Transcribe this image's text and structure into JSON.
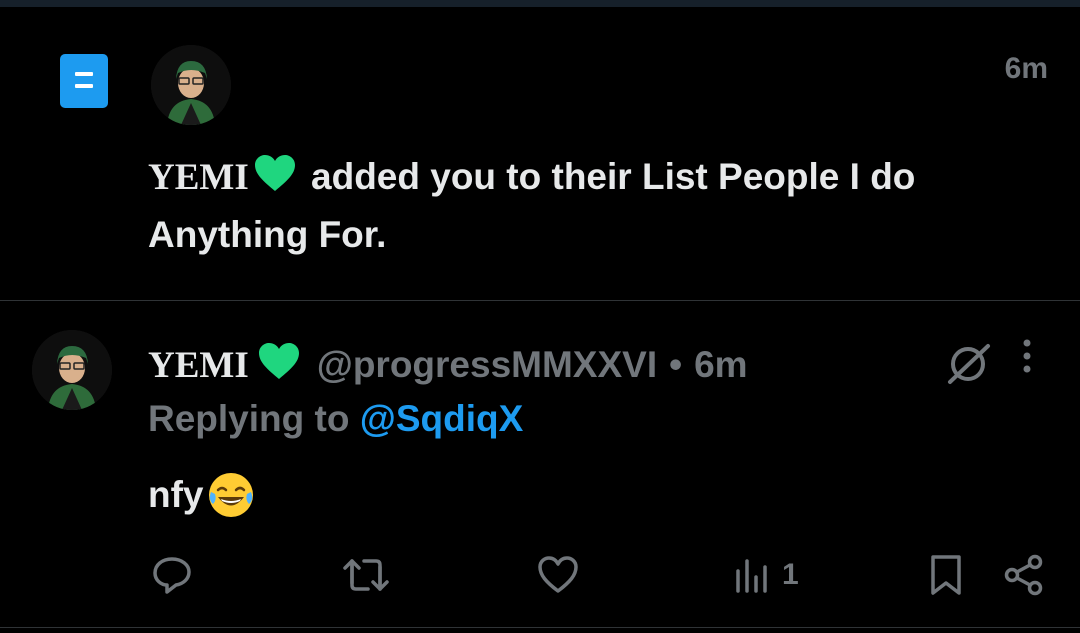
{
  "notification": {
    "time": "6m",
    "actor_name": "YEMI",
    "text_middle": " added you to their List ",
    "list_name": "People I do Anything For."
  },
  "reply": {
    "author_name": "YEMI",
    "handle": "@progressMMXXVI",
    "separator": "•",
    "time": "6m",
    "replying_prefix": "Replying to ",
    "replying_to": "@SqdiqX",
    "text": "nfy",
    "emoji": "face-with-tears-of-joy",
    "views": "1"
  },
  "icons": {
    "list": "list-icon",
    "heart": "green-heart-icon",
    "grok": "grok-icon",
    "more": "more-vertical-icon",
    "reply": "reply-icon",
    "retweet": "retweet-icon",
    "like": "like-icon",
    "views": "views-icon",
    "bookmark": "bookmark-icon",
    "share": "share-icon"
  },
  "colors": {
    "background": "#000000",
    "accent": "#1d9bf0",
    "muted": "#71767b",
    "text": "#e7e9ea",
    "heart": "#1fd67f"
  }
}
